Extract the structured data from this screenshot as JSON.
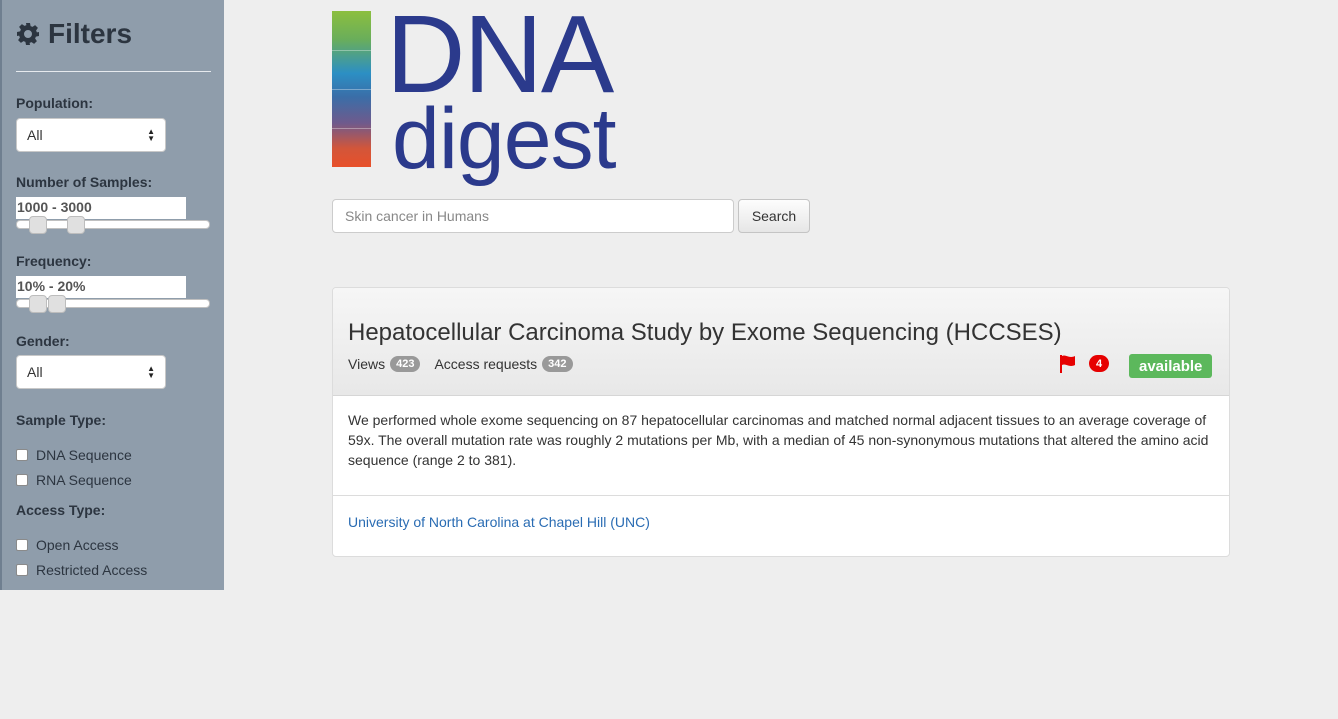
{
  "sidebar": {
    "title": "Filters",
    "population": {
      "label": "Population:",
      "value": "All"
    },
    "samples": {
      "label": "Number of Samples:",
      "value": "1000 - 3000"
    },
    "frequency": {
      "label": "Frequency:",
      "value": "10% - 20%"
    },
    "gender": {
      "label": "Gender:",
      "value": "All"
    },
    "sample_type": {
      "label": "Sample Type:",
      "options": [
        "DNA Sequence",
        "RNA Sequence"
      ]
    },
    "access_type": {
      "label": "Access Type:",
      "options": [
        "Open Access",
        "Restricted Access"
      ]
    }
  },
  "logo": {
    "line1": "DNA",
    "line2": "digest"
  },
  "search": {
    "placeholder": "Skin cancer in Humans",
    "button_label": "Search"
  },
  "result": {
    "title": "Hepatocellular Carcinoma Study by Exome Sequencing (HCCSES)",
    "views_label": "Views",
    "views_count": "423",
    "requests_label": "Access requests",
    "requests_count": "342",
    "flag_count": "4",
    "status": "available",
    "description": "We performed whole exome sequencing on 87 hepatocellular carcinomas and matched normal adjacent tissues to an average coverage of 59x. The overall mutation rate was roughly 2 mutations per Mb, with a median of 45 non-synonymous mutations that altered the amino acid sequence (range 2 to 381).",
    "institution": "University of North Carolina at Chapel Hill (UNC)"
  },
  "colors": {
    "sidebar_bg": "#8f9dab",
    "brand": "#2b3a8c",
    "status_green": "#5cb85c",
    "flag_red": "#e60000",
    "link_blue": "#2a6cb3"
  }
}
